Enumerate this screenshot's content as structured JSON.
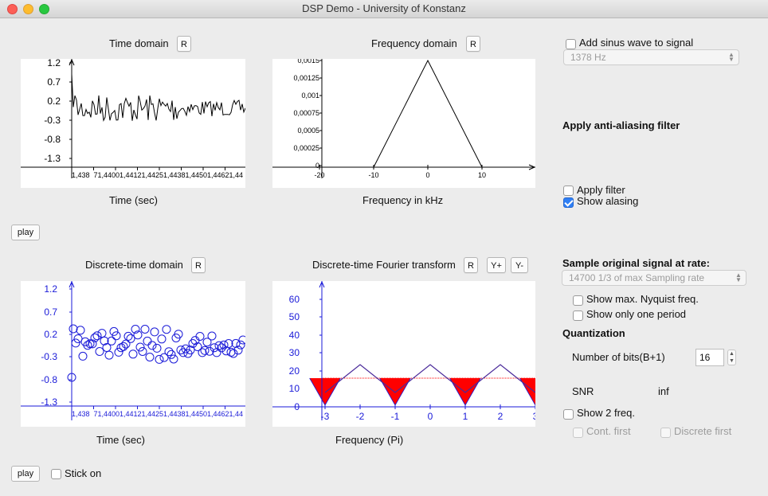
{
  "window": {
    "title": "DSP Demo - University of Konstanz"
  },
  "time_domain": {
    "title": "Time domain",
    "reset_label": "R",
    "xlabel": "Time (sec)",
    "y_ticks": [
      "1.2",
      "0.7",
      "0.2",
      "-0.3",
      "-0.8",
      "-1.3"
    ],
    "x_ticks": [
      "1,438",
      "71,440",
      "01,441",
      "21,442",
      "51,443",
      "81,445",
      "01,446",
      "21,44"
    ]
  },
  "frequency_domain": {
    "title": "Frequency domain",
    "reset_label": "R",
    "xlabel": "Frequency in kHz",
    "y_ticks": [
      "0,0015",
      "0,00125",
      "0,001",
      "0,00075",
      "0,0005",
      "0,00025",
      "0"
    ],
    "x_ticks": [
      "-20",
      "-10",
      "0",
      "10"
    ]
  },
  "discrete_time_domain": {
    "title": "Discrete-time domain",
    "reset_label": "R",
    "xlabel": "Time (sec)",
    "y_ticks": [
      "1.2",
      "0.7",
      "0.2",
      "-0.3",
      "-0.8",
      "-1.3"
    ],
    "x_ticks": [
      "1,438",
      "71,440",
      "01,441",
      "21,442",
      "51,443",
      "81,445",
      "01,446",
      "21,44"
    ]
  },
  "dtft": {
    "title": "Discrete-time Fourier transform",
    "reset_label": "R",
    "yplus_label": "Y+",
    "yminus_label": "Y-",
    "xlabel": "Frequency (Pi)",
    "y_ticks": [
      "60",
      "50",
      "40",
      "30",
      "20",
      "10",
      "0"
    ],
    "x_ticks": [
      "-3",
      "-2",
      "-1",
      "0",
      "1",
      "2",
      "3"
    ]
  },
  "play_top_label": "play",
  "play_bottom_label": "play",
  "stick_on_label": "Stick on",
  "controls": {
    "add_sinus_label": "Add sinus wave to signal",
    "sinus_freq_value": "1378 Hz",
    "anti_alias_heading": "Apply anti-aliasing filter",
    "apply_filter_label": "Apply filter",
    "show_aliasing_label": "Show alasing",
    "sample_rate_heading": "Sample original signal at rate:",
    "sample_rate_value": "14700 1/3 of max Sampling rate",
    "show_nyquist_label": "Show max. Nyquist freq.",
    "show_one_period_label": "Show only one period",
    "quantization_heading": "Quantization",
    "bits_label": "Number of bits(B+1)",
    "bits_value": "16",
    "snr_label": "SNR",
    "snr_value": "inf",
    "show_2freq_label": "Show 2 freq.",
    "cont_first_label": "Cont. first",
    "discrete_first_label": "Discrete first"
  },
  "colors": {
    "discrete_blue": "#1a1ad8",
    "dtft_red": "#ff0000",
    "checkbox_accent": "#2f7ff5"
  }
}
